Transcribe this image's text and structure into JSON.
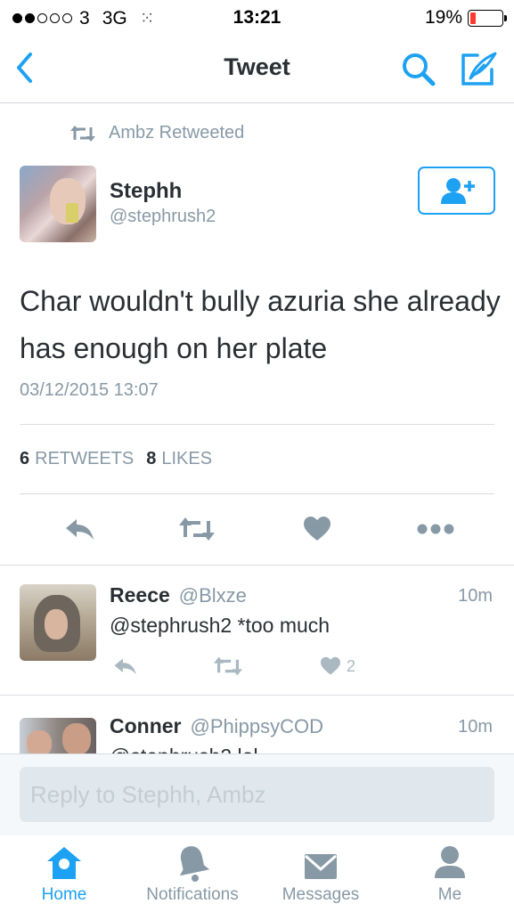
{
  "status_bar": {
    "carrier": "3",
    "network": "3G",
    "time": "13:21",
    "battery": "19%",
    "battery_level": 0.19
  },
  "nav": {
    "title": "Tweet",
    "back_icon": "chevron-left-icon",
    "search_icon": "search-icon",
    "compose_icon": "compose-icon"
  },
  "tweet": {
    "retweeted_by": "Ambz Retweeted",
    "author_name": "Stephh",
    "author_handle": "@stephrush2",
    "text": "Char wouldn't bully azuria she already has enough on her plate",
    "timestamp": "03/12/2015 13:07",
    "retweets_count": "6",
    "retweets_label": "RETWEETS",
    "likes_count": "8",
    "likes_label": "LIKES"
  },
  "replies": [
    {
      "name": "Reece",
      "handle": "@Blxze",
      "time": "10m",
      "text": "@stephrush2 *too much",
      "likes": "2"
    },
    {
      "name": "Conner",
      "handle": "@PhippsyCOD",
      "time": "10m",
      "text": "@stephrush2 lol"
    }
  ],
  "reply_box": {
    "placeholder": "Reply to Stephh, Ambz"
  },
  "tabs": [
    {
      "label": "Home",
      "icon": "home-icon",
      "active": true
    },
    {
      "label": "Notifications",
      "icon": "bell-icon",
      "active": false
    },
    {
      "label": "Messages",
      "icon": "envelope-icon",
      "active": false
    },
    {
      "label": "Me",
      "icon": "person-icon",
      "active": false
    }
  ],
  "colors": {
    "accent": "#1da1f2",
    "muted": "#8899a6",
    "text": "#292f33",
    "battery_low": "#ff3b30"
  }
}
